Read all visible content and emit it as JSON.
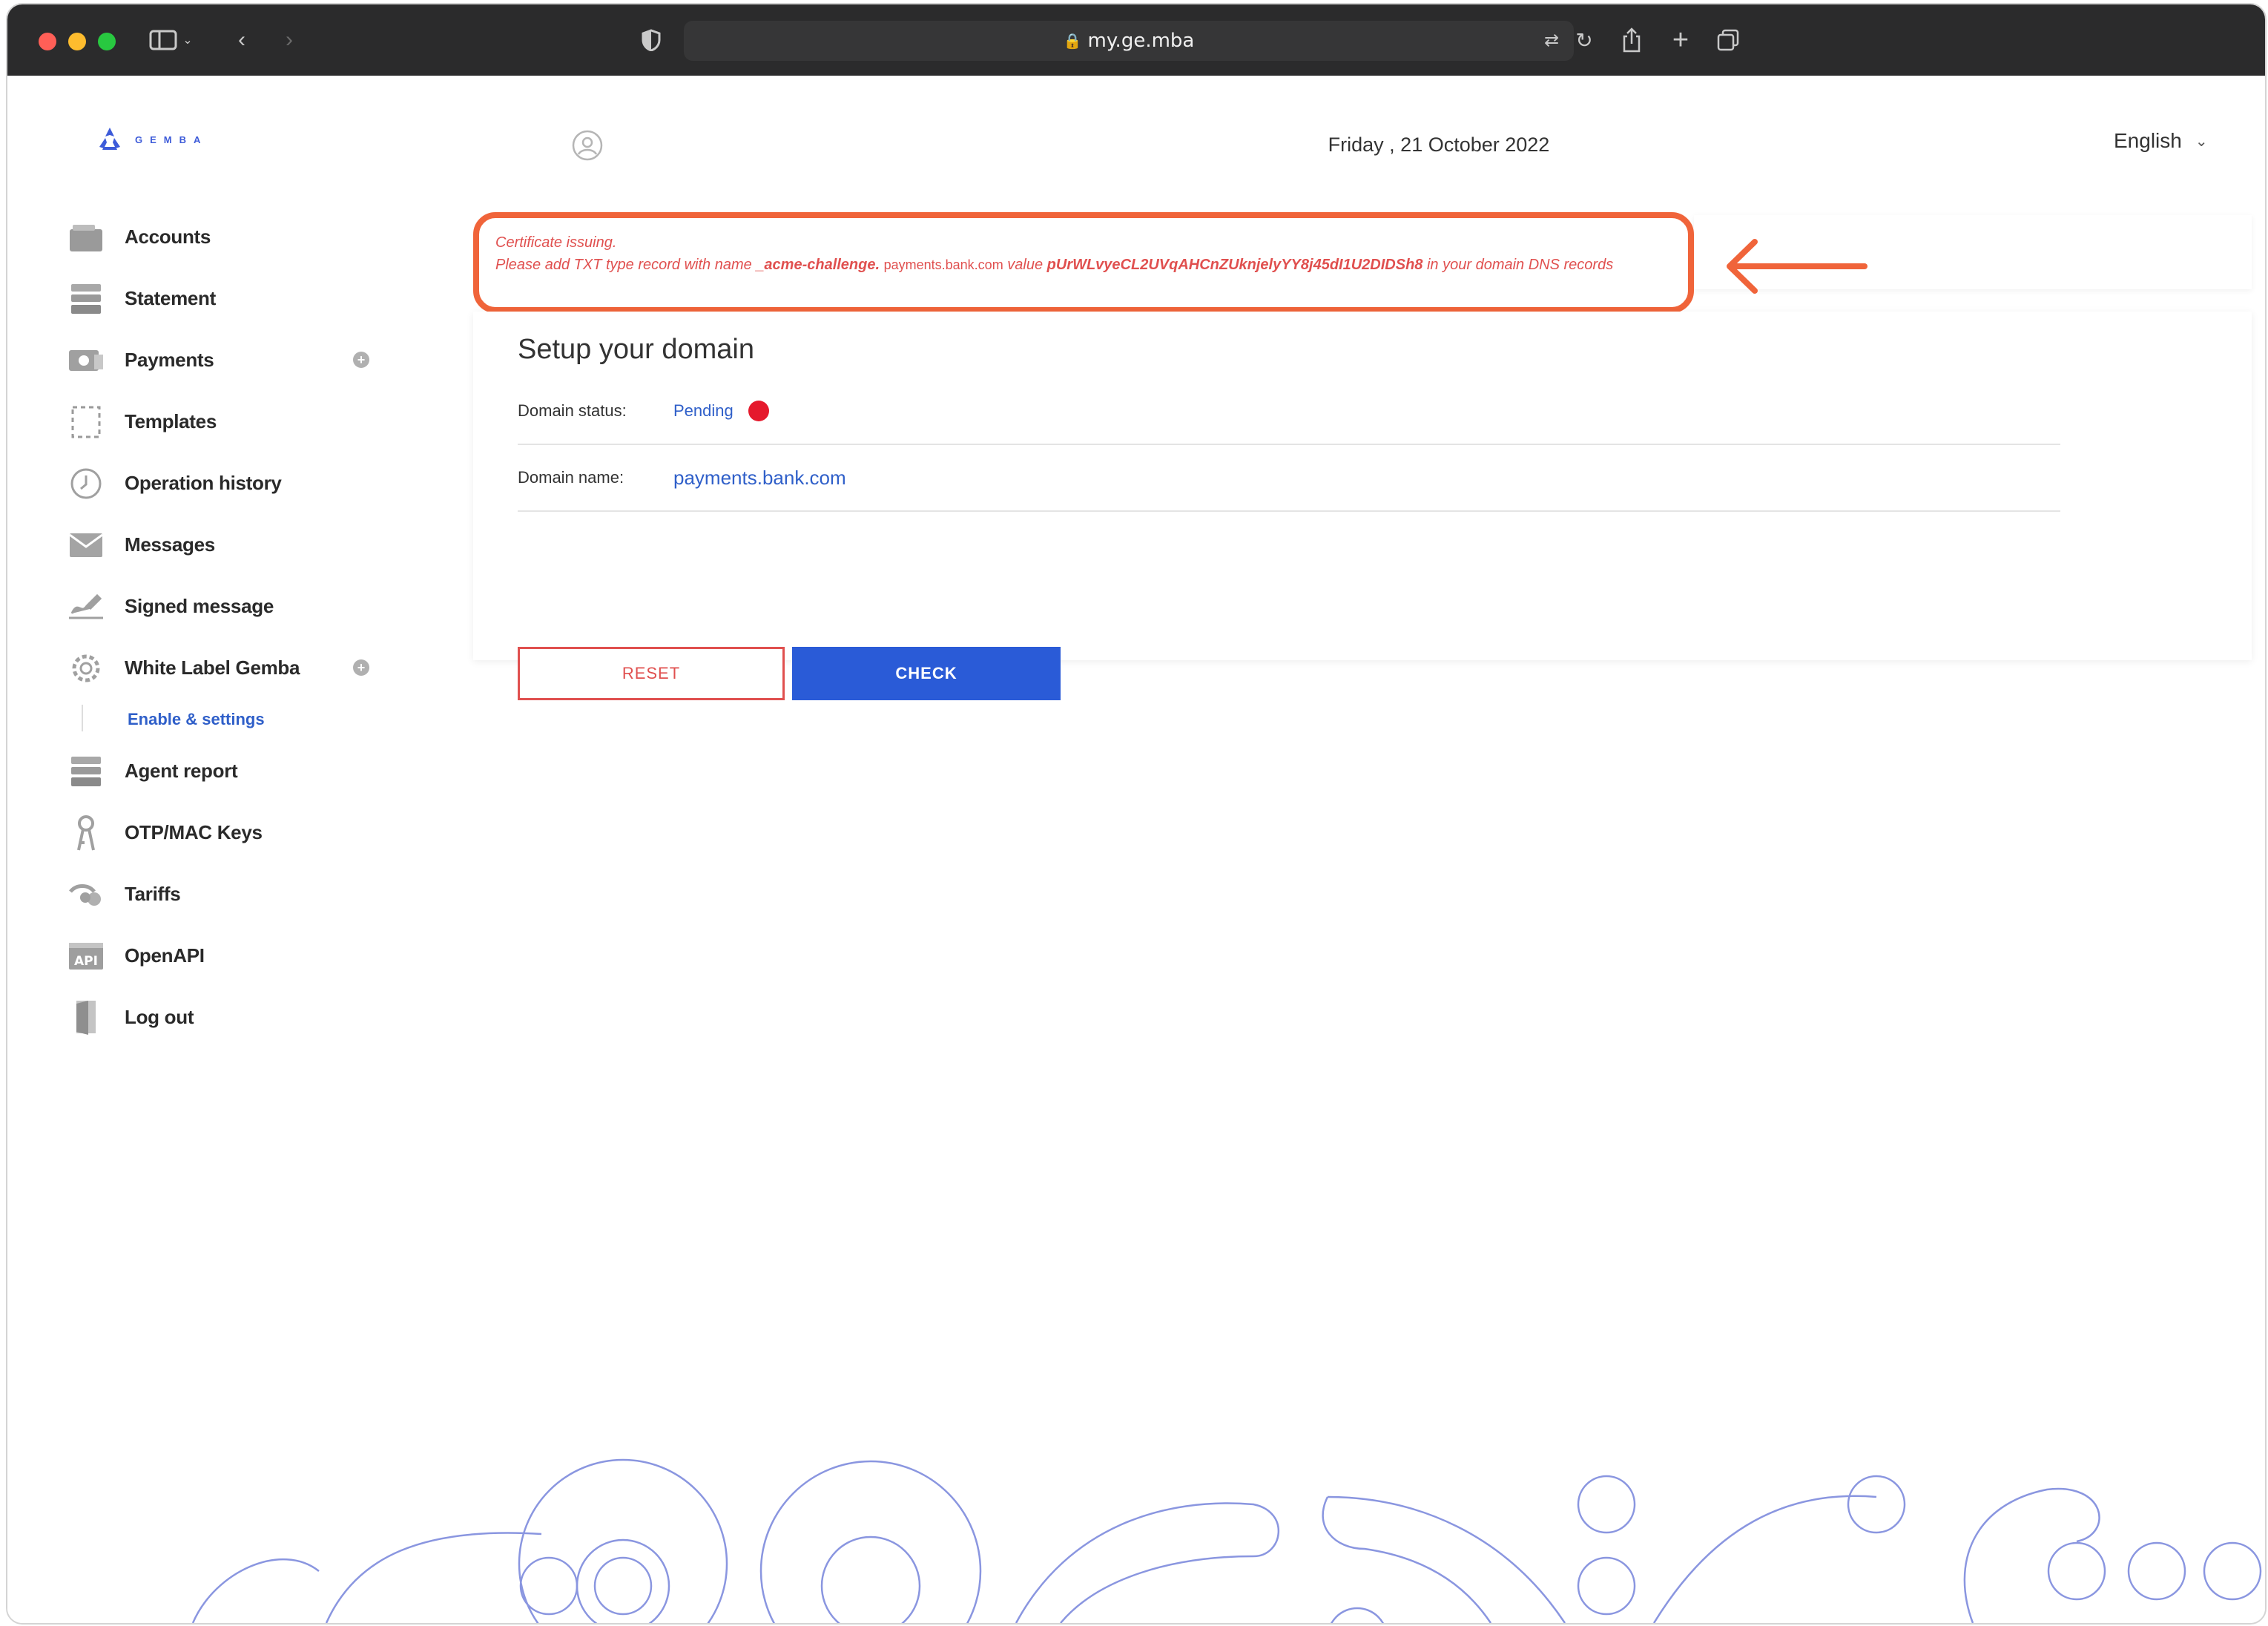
{
  "browser": {
    "url": "my.ge.mba"
  },
  "header": {
    "logo_text": "GEMBA",
    "date": "Friday , 21 October 2022",
    "language": "English"
  },
  "sidebar": {
    "items": [
      {
        "label": "Accounts",
        "icon": "wallet-icon"
      },
      {
        "label": "Statement",
        "icon": "document-stack-icon"
      },
      {
        "label": "Payments",
        "icon": "payment-card-icon",
        "expandable": true
      },
      {
        "label": "Templates",
        "icon": "dashed-square-icon"
      },
      {
        "label": "Operation history",
        "icon": "history-clock-icon"
      },
      {
        "label": "Messages",
        "icon": "envelope-icon"
      },
      {
        "label": "Signed message",
        "icon": "signature-icon"
      },
      {
        "label": "White Label Gemba",
        "icon": "gear-icon",
        "expandable": true
      },
      {
        "label": "Agent report",
        "icon": "report-stack-icon"
      },
      {
        "label": "OTP/MAC Keys",
        "icon": "key-icon"
      },
      {
        "label": "Tariffs",
        "icon": "coins-icon"
      },
      {
        "label": "OpenAPI",
        "icon": "api-icon"
      },
      {
        "label": "Log out",
        "icon": "door-icon"
      }
    ],
    "subitem": {
      "label": "Enable & settings"
    }
  },
  "alert": {
    "line1": "Certificate issuing.",
    "prefix": "Please add TXT type record with name",
    "name": "_acme-challenge.",
    "domain": "payments.bank.com",
    "value_label": "value",
    "value": "pUrWLvyeCL2UVqAHCnZUknjelyYY8j45dI1U2DIDSh8",
    "suffix": "in your domain DNS records"
  },
  "card": {
    "title": "Setup your domain",
    "status_label": "Domain status:",
    "status_value": "Pending",
    "status_color": "#e5192c",
    "name_label": "Domain name:",
    "name_value": "payments.bank.com",
    "reset_label": "RESET",
    "check_label": "CHECK"
  },
  "colors": {
    "accent": "#2a5bd7",
    "alert": "#e0504f",
    "highlight": "#f0643a"
  }
}
